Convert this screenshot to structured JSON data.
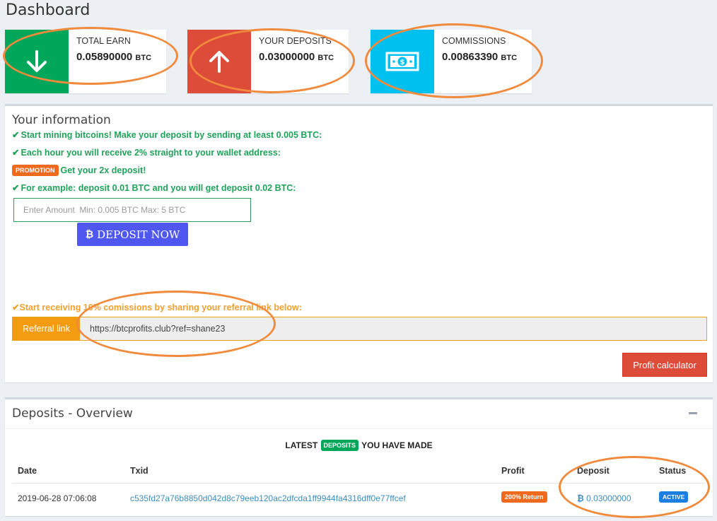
{
  "page": {
    "title": "Dashboard"
  },
  "stats": [
    {
      "label": "TOTAL EARN",
      "value": "0.05890000",
      "unit": "BTC",
      "color": "#00a65a",
      "icon": "arrow-down-icon"
    },
    {
      "label": "YOUR DEPOSITS",
      "value": "0.03000000",
      "unit": "BTC",
      "color": "#dd4b39",
      "icon": "arrow-up-icon"
    },
    {
      "label": "COMMISSIONS",
      "value": "0.00863390",
      "unit": "BTC",
      "color": "#00c0ef",
      "icon": "money-icon"
    }
  ],
  "info": {
    "title": "Your information",
    "line1": "Start mining bitcoins! Make your deposit by sending at least 0.005 BTC:",
    "line2": "Each hour you will receive 2% straight to your wallet address:",
    "promo_badge": "PROMOTION",
    "promo_text": "Get your 2x deposit!",
    "line3": "For example: deposit 0.01 BTC and you will get deposit 0.02 BTC:",
    "amount_placeholder": "Enter Amount  Min: 0.005 BTC Max: 5 BTC",
    "deposit_button": "DEPOSIT NOW",
    "referral_line": "Start receiving 10% comissions by sharing your referral link below:",
    "referral_label": "Referral link",
    "referral_url": "https://btcprofits.club?ref=shane23",
    "calculator_button": "Profit calculator"
  },
  "deposits": {
    "title": "Deposits - Overview",
    "latest_prefix": "LATEST",
    "latest_badge": "DEPOSITS",
    "latest_suffix": "YOU HAVE MADE",
    "columns": {
      "date": "Date",
      "txid": "Txid",
      "profit": "Profit",
      "deposit": "Deposit",
      "status": "Status"
    },
    "rows": [
      {
        "date": "2019-06-28 07:06:08",
        "txid": "c535fd27a76b8850d042d8c79eeb120ac2dfcda1ff9944fa4316dff0e77ffcef",
        "profit": "200% Return",
        "deposit": "0.03000000",
        "status": "ACTIVE"
      }
    ]
  },
  "colors": {
    "annotation": "#f08a3c",
    "green": "#20a25a",
    "orange": "#f39c12",
    "blue_button": "#4f57f0"
  }
}
